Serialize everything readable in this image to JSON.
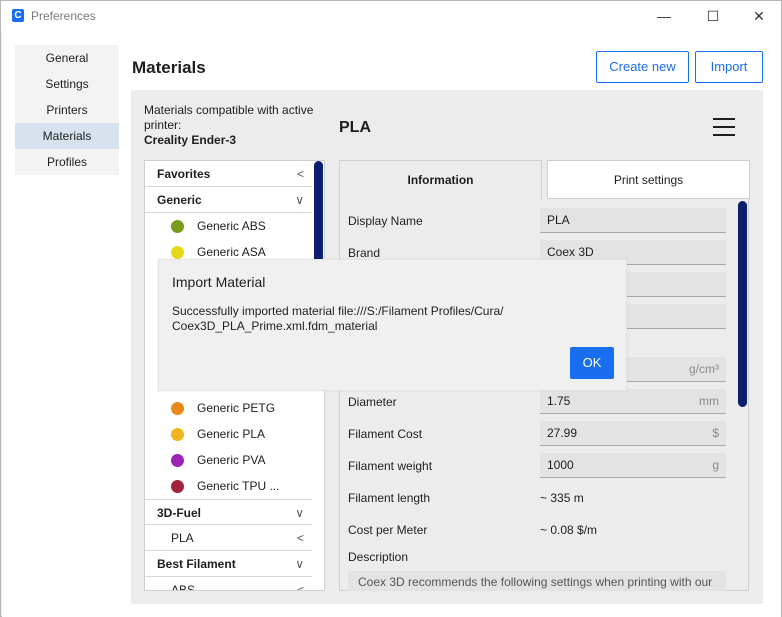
{
  "window": {
    "app_icon": "C",
    "title": "Preferences",
    "minimize": "—",
    "maximize": "☐",
    "close": "✕"
  },
  "nav": {
    "items": [
      {
        "label": "General",
        "active": false
      },
      {
        "label": "Settings",
        "active": false
      },
      {
        "label": "Printers",
        "active": false
      },
      {
        "label": "Materials",
        "active": true
      },
      {
        "label": "Profiles",
        "active": false
      }
    ]
  },
  "header": {
    "title": "Materials",
    "create_new": "Create new",
    "import": "Import"
  },
  "compatibility": {
    "text": "Materials compatible with active printer:",
    "printer": "Creality Ender-3"
  },
  "material_list": {
    "favorites": {
      "label": "Favorites",
      "chevron": "<"
    },
    "generic": {
      "label": "Generic",
      "chevron": "∨"
    },
    "generic_items": [
      {
        "name": "Generic ABS",
        "color": "#7a9a1d"
      },
      {
        "name": "Generic ASA",
        "color": "#e8d619"
      },
      {
        "name": "Generic PETG",
        "color": "#e8891a"
      },
      {
        "name": "Generic PLA",
        "color": "#f0b51c"
      },
      {
        "name": "Generic PVA",
        "color": "#9b23b8"
      },
      {
        "name": "Generic TPU ...",
        "color": "#a3233c"
      }
    ],
    "fuel": {
      "label": "3D-Fuel",
      "chevron": "∨"
    },
    "fuel_sub": {
      "label": "PLA",
      "chevron": "<"
    },
    "best": {
      "label": "Best Filament",
      "chevron": "∨"
    },
    "best_sub": {
      "label": "ABS",
      "chevron": "<"
    }
  },
  "material": {
    "name": "PLA",
    "tabs": {
      "information": "Information",
      "print_settings": "Print settings"
    },
    "fields": {
      "display_name_label": "Display Name",
      "display_name": "PLA",
      "brand_label": "Brand",
      "brand": "Coex 3D",
      "density_unit": "g/cm³",
      "diameter_label": "Diameter",
      "diameter": "1.75",
      "diameter_unit": "mm",
      "cost_label": "Filament Cost",
      "cost": "27.99",
      "cost_unit": "$",
      "weight_label": "Filament weight",
      "weight": "1000",
      "weight_unit": "g",
      "length_label": "Filament length",
      "length": "~ 335 m",
      "cpm_label": "Cost per Meter",
      "cpm": "~ 0.08 $/m",
      "description_label": "Description",
      "description": "Coex 3D recommends the following settings when printing with our"
    }
  },
  "dialog": {
    "title": "Import Material",
    "message": "Successfully imported material file:///S:/Filament Profiles/Cura/ Coex3D_PLA_Prime.xml.fdm_material",
    "ok": "OK"
  }
}
